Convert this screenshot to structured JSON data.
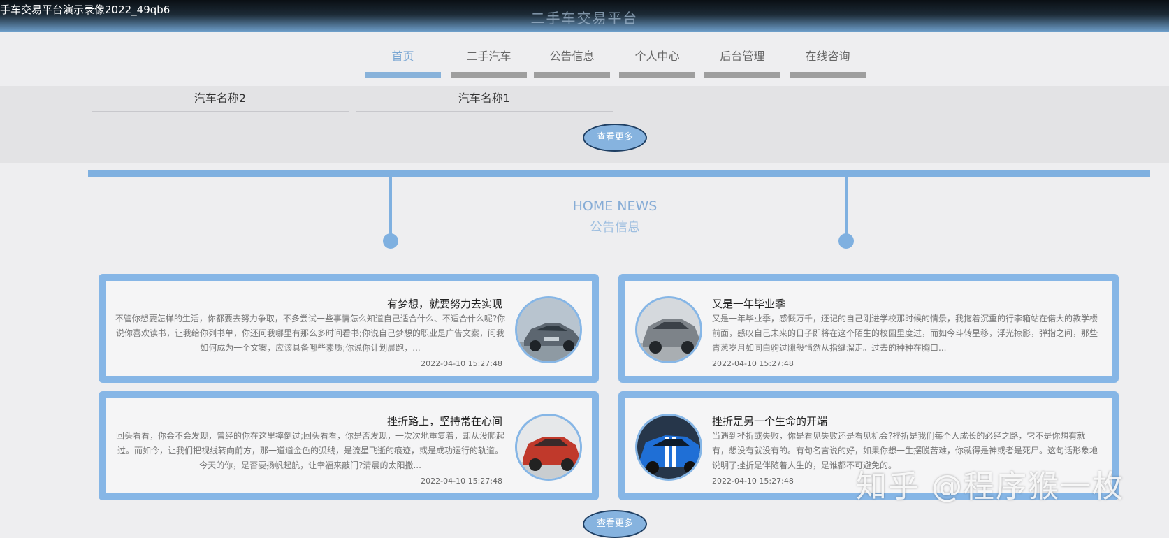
{
  "window": {
    "recording_title": "手车交易平台演示录像2022_49qb6",
    "site_title": "二手车交易平台"
  },
  "nav": {
    "items": [
      {
        "label": "首页",
        "active": true
      },
      {
        "label": "二手汽车",
        "active": false
      },
      {
        "label": "公告信息",
        "active": false
      },
      {
        "label": "个人中心",
        "active": false
      },
      {
        "label": "后台管理",
        "active": false
      },
      {
        "label": "在线咨询",
        "active": false
      }
    ]
  },
  "cars": {
    "items": [
      {
        "name": "汽车名称2"
      },
      {
        "name": "汽车名称1"
      }
    ],
    "more_label": "查看更多"
  },
  "news": {
    "heading_en": "HOME NEWS",
    "heading_cn": "公告信息",
    "more_label": "查看更多",
    "items": [
      {
        "title": "有梦想，就要努力去实现",
        "excerpt": "不管你想要怎样的生活，你都要去努力争取，不多尝试一些事情怎么知道自己适合什么、不适合什么呢?你说你喜欢读书，让我给你列书单，你还问我哪里有那么多时间看书;你说自己梦想的职业是广告文案，问我如何成为一个文案，应该具备哪些素质;你说你计划晨跑，...",
        "date": "2022-04-10 15:27:48",
        "thumb_icon": "silver-sedan-photo"
      },
      {
        "title": "又是一年毕业季",
        "excerpt": "又是一年毕业季，感慨万千，还记的自己刚进学校那时候的情景，我拖着沉重的行李箱站在偌大的教学楼前面，感叹自己未来的日子即将在这个陌生的校园里度过，而如今斗转星移，浮光掠影，弹指之间，那些青葱岁月如同白驹过隙般悄然从指缝溜走。过去的种种在胸口...",
        "date": "2022-04-10 15:27:48",
        "thumb_icon": "grey-suv-photo"
      },
      {
        "title": "挫折路上，坚持常在心间",
        "excerpt": "回头看看，你会不会发现，曾经的你在这里摔倒过;回头看看，你是否发现，一次次地重复着，却从没爬起过。而如今，让我们把视线转向前方，那一道道金色的弧线，是流星飞逝的痕迹，或是成功运行的轨道。今天的你，是否要扬帆起航，让幸福来敲门?清晨的太阳撒...",
        "date": "2022-04-10 15:27:48",
        "thumb_icon": "red-suv-photo"
      },
      {
        "title": "挫折是另一个生命的开端",
        "excerpt": "当遇到挫折或失败，你是看见失败还是看见机会?挫折是我们每个人成长的必经之路，它不是你想有就有，想没有就没有的。有句名言说的好，如果你想一生摆脱苦难，你就得是神或者是死尸。这句话形象地说明了挫折是伴随着人生的，是谁都不可避免的。",
        "date": "2022-04-10 15:27:48",
        "thumb_icon": "blue-mustang-photo"
      }
    ]
  },
  "watermark": "知乎 @程序猴一枚",
  "colors": {
    "accent": "#86b6e6",
    "nav_inactive_bar": "#9e9e9e",
    "button_border": "#1f3f63"
  }
}
